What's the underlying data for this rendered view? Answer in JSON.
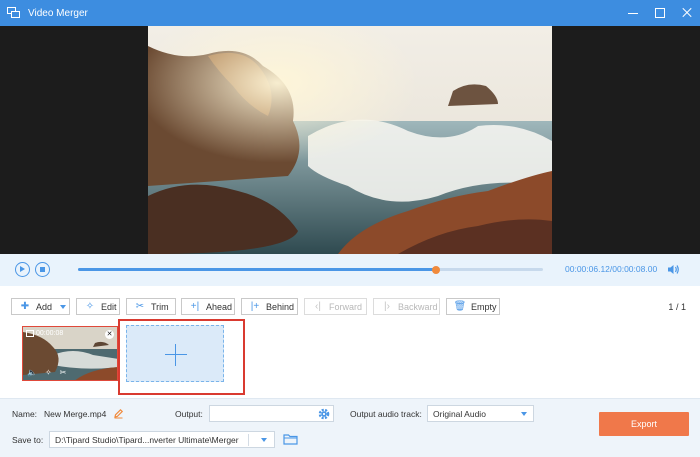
{
  "window": {
    "title": "Video Merger"
  },
  "icons": {
    "app": "window-stack-icon",
    "minimize": "minimize-icon",
    "maximize": "maximize-icon",
    "close": "close-icon",
    "play": "play-icon",
    "stop": "stop-icon",
    "volume": "volume-icon",
    "add": "plus-icon",
    "edit": "magic-wand-icon",
    "trim": "scissors-icon",
    "ahead": "plus-bar-icon",
    "behind": "bar-plus-icon",
    "forward": "chevron-left-bar-icon",
    "backward": "bar-chevron-right-icon",
    "empty": "trash-icon",
    "rename": "pencil-icon",
    "settings": "gear-icon",
    "folder": "folder-icon"
  },
  "player": {
    "current_time": "00:00:06.12",
    "total_time": "/00:00:08.00",
    "progress": 0.77
  },
  "toolbar": {
    "add": "Add",
    "edit": "Edit",
    "trim": "Trim",
    "ahead": "Ahead",
    "behind": "Behind",
    "forward": "Forward",
    "backward": "Backward",
    "empty": "Empty",
    "page_current": "1",
    "page_separator": "/",
    "page_total": "1"
  },
  "clip": {
    "duration": "00:00:08"
  },
  "bottom": {
    "name_label": "Name:",
    "name_value": "New Merge.mp4",
    "output_label": "Output:",
    "output_value": "",
    "audio_label": "Output audio track:",
    "audio_value": "Original Audio",
    "save_label": "Save to:",
    "save_path": "D:\\Tipard Studio\\Tipard...nverter Ultimate\\Merger",
    "export": "Export"
  },
  "colors": {
    "titlebar": "#3d8de0",
    "accent": "#4a96e6",
    "playhead": "#f08a3c",
    "export": "#f0784a",
    "highlight": "#d93a30"
  }
}
